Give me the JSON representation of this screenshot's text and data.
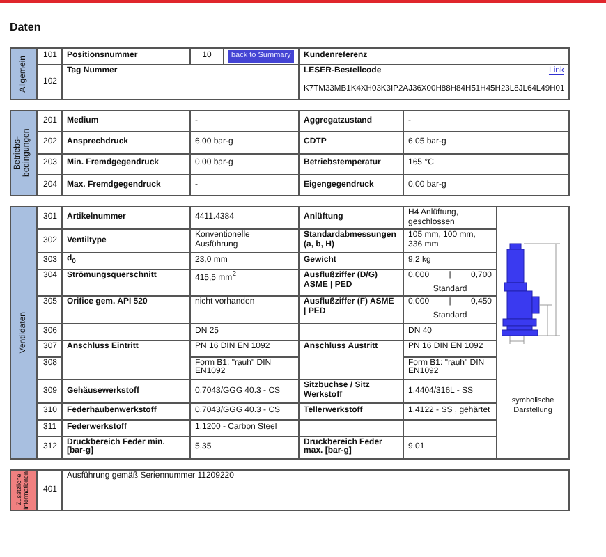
{
  "title": "Daten",
  "general": {
    "label": "Allgemein",
    "color": "#a8bfe0",
    "rows": [
      {
        "number": "101",
        "label": "Positionsnummer",
        "value": "10",
        "link": "back to Summary",
        "right_label": "Kundenreferenz"
      },
      {
        "number": "102",
        "label": "Tag Nummer",
        "right_label": "LESER-Bestellcode",
        "right_link": "Link",
        "right_value": "K7TM33MB1K4XH03K3IP2AJ36X00H88H84H51H45H23L8JL64L49H01"
      }
    ]
  },
  "operating_conditions": {
    "label": "Betriebs- bedingungen",
    "color": "#a8bfe0",
    "rows": [
      {
        "number": "201",
        "label": "Medium",
        "value": "-",
        "right_label": "Aggregatzustand",
        "right_value": "-"
      },
      {
        "number": "202",
        "label": "Ansprechdruck",
        "value": "6,00 bar-g",
        "right_label": "CDTP",
        "right_value": "6,05 bar-g"
      },
      {
        "number": "203",
        "label": "Min. Fremdgegendruck",
        "value": "0,00 bar-g",
        "right_label": "Betriebstemperatur",
        "right_value": "165 °C"
      },
      {
        "number": "204",
        "label": "Max. Fremdgegendruck",
        "value": "-",
        "right_label": "Eigengegendruck",
        "right_value": "0,00 bar-g"
      }
    ]
  },
  "valve_data": {
    "label": "Ventildaten",
    "color": "#a8bfe0",
    "figure_caption": "symbolische Darstellung",
    "rows": [
      {
        "kind": "plain",
        "number": "301",
        "label": "Artikelnummer",
        "value": "4411.4384",
        "right_label": "Anlüftung",
        "right_value": "H4 Anlüftung, geschlossen"
      },
      {
        "kind": "plain",
        "number": "302",
        "label": "Ventiltype",
        "value": "Konventionelle Ausführung",
        "right_label": "Standardabmessungen (a, b, H)",
        "right_value": "105 mm, 100 mm, 336 mm"
      },
      {
        "kind": "plain",
        "number": "303",
        "label": "d$_{0}$",
        "value": "23,0 mm",
        "right_label": "Gewicht",
        "right_value": "9,2 kg"
      },
      {
        "kind": "coefficient",
        "number": "304",
        "label": "Strömungsquerschnitt",
        "value": "415,5 mm$^{2}$",
        "right_label": "Ausflußziffer (D/G) ASME | PED",
        "right_value": {
          "low": "0,000",
          "separator": "|",
          "high": "0,700",
          "note": "Standard"
        }
      },
      {
        "kind": "coefficient",
        "number": "305",
        "label": "Orifice gem. API 520",
        "value": "nicht vorhanden",
        "right_label": "Ausflußziffer (F) ASME | PED",
        "right_value": {
          "low": "0,000",
          "separator": "|",
          "high": "0,450",
          "note": "Standard"
        }
      },
      {
        "kind": "plain",
        "number": "306",
        "value": "DN 25",
        "right_value": "DN 40"
      },
      {
        "kind": "plain",
        "number": "307",
        "label": "Anschluss Eintritt",
        "value": "PN 16 DIN EN 1092",
        "right_label": "Anschluss Austritt",
        "right_value": "PN 16 DIN EN 1092"
      },
      {
        "kind": "continued",
        "number": "308",
        "value": "Form B1: \"rauh\" DIN EN1092",
        "right_value": "Form B1: \"rauh\" DIN EN1092"
      },
      {
        "kind": "plain",
        "number": "309",
        "label": "Gehäusewerkstoff",
        "value": "0.7043/GGG 40.3 - CS",
        "right_label": "Sitzbuchse / Sitz Werkstoff",
        "right_value": "1.4404/316L - SS"
      },
      {
        "kind": "plain",
        "number": "310",
        "label": "Federhaubenwerkstoff",
        "value": "0.7043/GGG 40.3 - CS",
        "right_label": "Tellerwerkstoff",
        "right_value": "1.4122 - SS , gehärtet"
      },
      {
        "kind": "plain",
        "number": "311",
        "label": "Federwerkstoff",
        "value": "1.1200 - Carbon Steel"
      },
      {
        "kind": "plain",
        "number": "312",
        "label": "Druckbereich Feder min. [bar-g]",
        "value": "5,35",
        "right_label": "Druckbereich Feder max. [bar-g]",
        "right_value": "9,01"
      }
    ]
  },
  "additional_info": {
    "label": "Zusätzliche Informationen",
    "color": "#f08080",
    "rows": [
      {
        "number": "401",
        "text": "Ausführung gemäß Seriennummer 11209220"
      }
    ]
  }
}
